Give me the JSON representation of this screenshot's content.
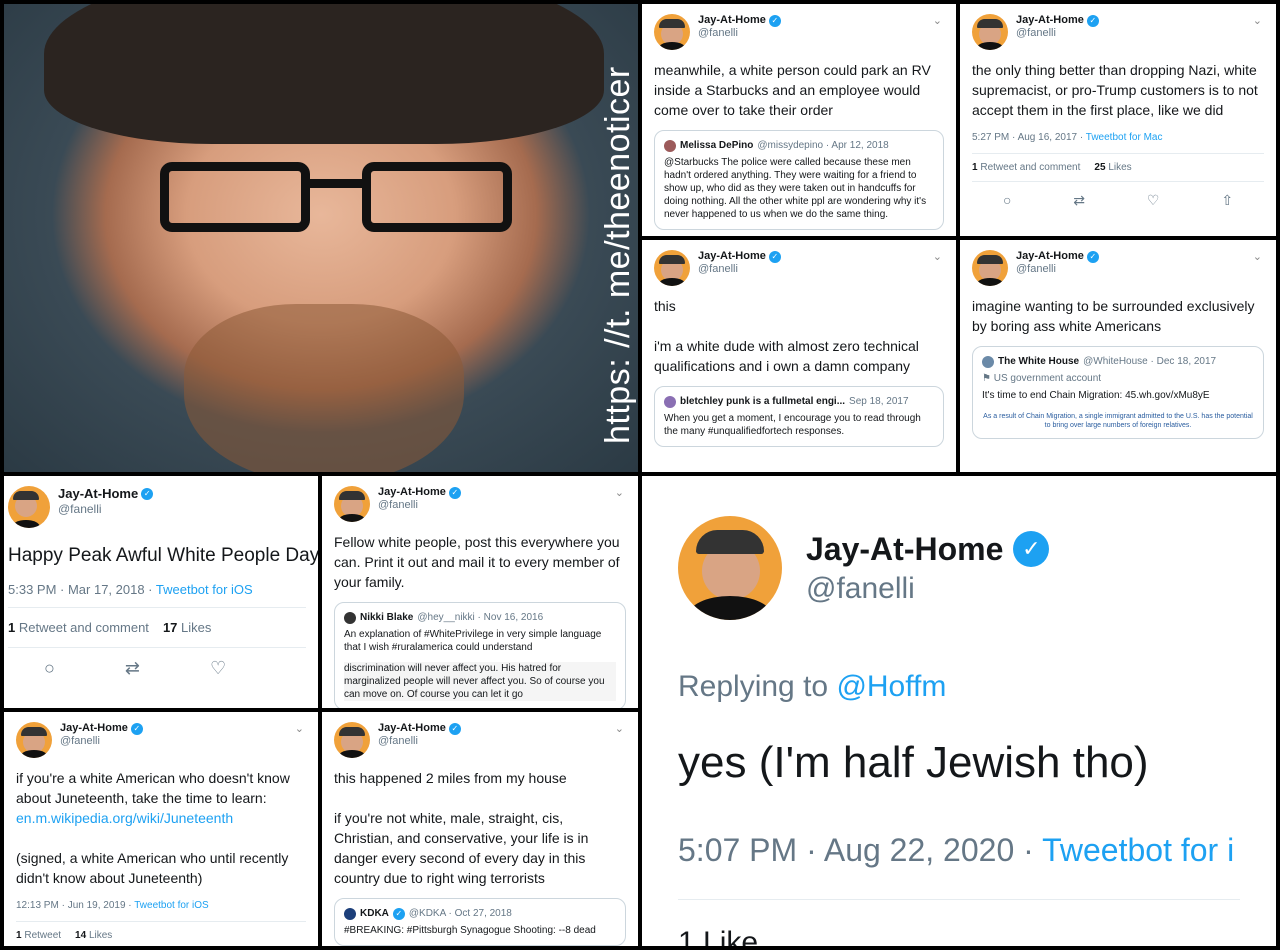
{
  "photo": {
    "watermark": "https: //t. me/theenoticer"
  },
  "t1": {
    "name": "Jay-At-Home",
    "handle": "@fanelli",
    "text": "meanwhile, a white person could park an RV inside a Starbucks and an employee would come over to take their order",
    "quote": {
      "name": "Melissa DePino",
      "meta": "@missydepino · Apr 12, 2018",
      "text": "@Starbucks The police were called because these men hadn't ordered anything. They were waiting for a friend to show up, who did as they were taken out in handcuffs for doing nothing. All the other white ppl are wondering why it's never happened to us when we do the same thing."
    }
  },
  "t2": {
    "name": "Jay-At-Home",
    "handle": "@fanelli",
    "text": "the only thing better than dropping Nazi, white supremacist, or pro-Trump customers is to not accept them in the first place, like we did",
    "time": "5:27 PM · Aug 16, 2017 · ",
    "client": "Tweetbot for Mac",
    "retweets": "1",
    "retweets_label": "Retweet and comment",
    "likes": "25",
    "likes_label": "Likes"
  },
  "t3": {
    "name": "Jay-At-Home",
    "handle": "@fanelli",
    "line1": "this",
    "line2": "i'm a white dude with almost zero technical qualifications and i own a damn company",
    "quote": {
      "name": "bletchley punk is a fullmetal engi...",
      "meta": "Sep 18, 2017",
      "text": "When you get a moment, I encourage you to read through the many #unqualifiedfortech responses."
    }
  },
  "t4": {
    "name": "Jay-At-Home",
    "handle": "@fanelli",
    "text": "imagine wanting to be surrounded exclusively by boring ass white Americans",
    "quote": {
      "name": "The White House",
      "meta": "@WhiteHouse · Dec 18, 2017",
      "label": "US government account",
      "text": "It's time to end Chain Migration: 45.wh.gov/xMu8yE",
      "caption": "As a result of Chain Migration, a single immigrant admitted to the U.S. has the potential to bring over large numbers of foreign relatives."
    }
  },
  "t5": {
    "name": "Jay-At-Home",
    "handle": "@fanelli",
    "text": "Happy Peak Awful White People Day",
    "time": "5:33 PM · Mar 17, 2018 · ",
    "client": "Tweetbot for iOS",
    "retweets": "1",
    "retweets_label": "Retweet and comment",
    "likes": "17",
    "likes_label": "Likes"
  },
  "t6": {
    "name": "Jay-At-Home",
    "handle": "@fanelli",
    "text": "Fellow white people, post this everywhere you can. Print it out and mail it to every member of your family.",
    "quote": {
      "name": "Nikki Blake",
      "meta": "@hey__nikki · Nov 16, 2016",
      "text": "An explanation of #WhitePrivilege in very simple language that I wish #ruralamerica could understand",
      "image_text": "discrimination will never affect you. His hatred for marginalized people will never affect you. So of course you can move on. Of course you can let it go"
    }
  },
  "t7": {
    "name": "Jay-At-Home",
    "handle": "@fanelli",
    "text1": "if you're a white American who doesn't know about Juneteenth, take the time to learn: ",
    "link": "en.m.wikipedia.org/wiki/Juneteenth",
    "text2": "(signed, a white American who until recently didn't know about Juneteenth)",
    "time": "12:13 PM · Jun 19, 2019 · ",
    "client": "Tweetbot for iOS",
    "retweets": "1",
    "retweets_label": "Retweet",
    "likes": "14",
    "likes_label": "Likes"
  },
  "t8": {
    "name": "Jay-At-Home",
    "handle": "@fanelli",
    "line1": "this happened 2 miles from my house",
    "line2": "if you're not white, male, straight, cis, Christian, and conservative, your life is in danger every second of every day in this country due to right wing terrorists",
    "quote": {
      "name": "KDKA",
      "meta": "@KDKA · Oct 27, 2018",
      "text": "#BREAKING: #Pittsburgh Synagogue Shooting: --8 dead"
    }
  },
  "t9": {
    "name": "Jay-At-Home",
    "handle": "@fanelli",
    "replying": "Replying to ",
    "reply_to": "@Hoffm",
    "text": "yes (I'm half Jewish tho)",
    "time": "5:07 PM · Aug 22, 2020 · ",
    "client": "Tweetbot for i",
    "likes": "1 Like"
  }
}
